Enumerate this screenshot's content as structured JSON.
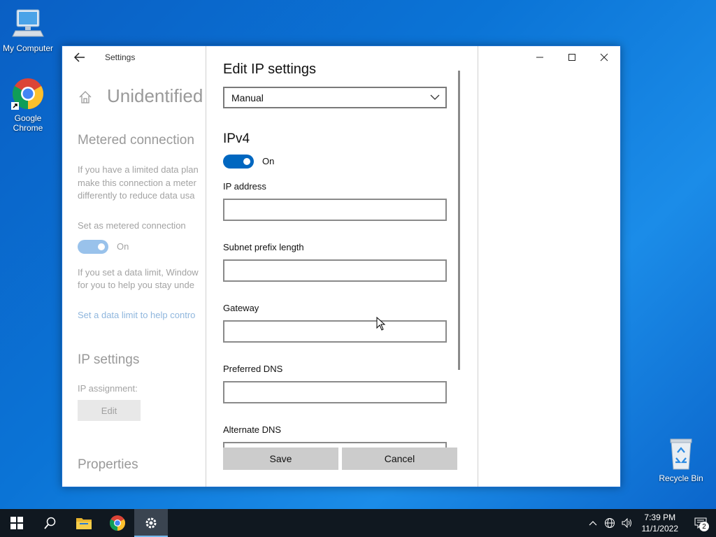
{
  "desktop": {
    "icons": [
      {
        "label": "My Computer"
      },
      {
        "label": "Google\nChrome"
      },
      {
        "label": "Recycle Bin"
      }
    ]
  },
  "window": {
    "title": "Settings",
    "controls": {
      "minimize": "minimize-icon",
      "maximize": "maximize-icon",
      "close": "close-icon"
    }
  },
  "background_page": {
    "title": "Unidentified",
    "metered_heading": "Metered connection",
    "metered_desc": [
      "If you have a limited data plan",
      "make this connection a meter",
      "differently to reduce data usa"
    ],
    "metered_label": "Set as metered connection",
    "metered_state": "On",
    "data_limit_desc": [
      "If you set a data limit, Window",
      "for you to help you stay unde"
    ],
    "data_limit_link": "Set a data limit to help contro",
    "ip_heading": "IP settings",
    "ip_assignment_label": "IP assignment:",
    "edit_button": "Edit",
    "properties_heading": "Properties"
  },
  "dialog": {
    "title": "Edit IP settings",
    "mode": "Manual",
    "ipv4_heading": "IPv4",
    "ipv4_toggle_state": "On",
    "fields": [
      {
        "label": "IP address",
        "value": ""
      },
      {
        "label": "Subnet prefix length",
        "value": ""
      },
      {
        "label": "Gateway",
        "value": ""
      },
      {
        "label": "Preferred DNS",
        "value": ""
      },
      {
        "label": "Alternate DNS",
        "value": ""
      }
    ],
    "save_label": "Save",
    "cancel_label": "Cancel"
  },
  "taskbar": {
    "apps": [
      "start-icon",
      "search-icon",
      "file-explorer-icon",
      "chrome-icon",
      "settings-icon"
    ],
    "time": "7:39 PM",
    "date": "11/1/2022",
    "notification_count": "2"
  },
  "colors": {
    "accent": "#0067c0",
    "desktop": "#0b74d6",
    "taskbar": "#101820"
  }
}
